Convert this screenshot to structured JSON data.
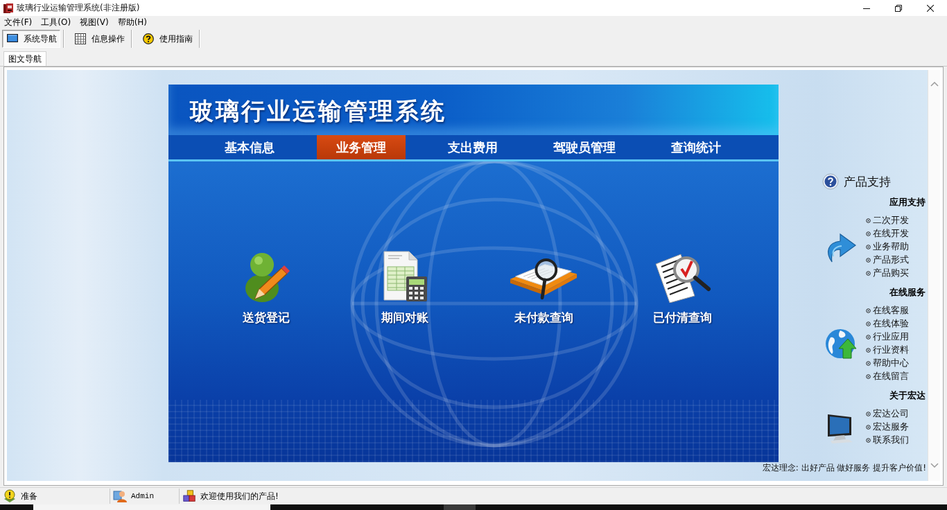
{
  "window": {
    "title": "玻璃行业运输管理系统(非注册版)"
  },
  "menu": [
    "文件(F)",
    "工具(O)",
    "视图(V)",
    "帮助(H)"
  ],
  "toolbar": [
    {
      "label": "系统导航",
      "kind": "monitor",
      "selected": true
    },
    {
      "label": "信息操作",
      "kind": "grid",
      "selected": false
    },
    {
      "label": "使用指南",
      "kind": "help",
      "selected": false
    }
  ],
  "tabs": [
    {
      "label": "图文导航",
      "selected": true
    }
  ],
  "banner": {
    "title": "玻璃行业运输管理系统",
    "nav": [
      {
        "label": "基本信息",
        "selected": false
      },
      {
        "label": "业务管理",
        "selected": true
      },
      {
        "label": "支出费用",
        "selected": false
      },
      {
        "label": "驾驶员管理",
        "selected": false
      },
      {
        "label": "查询统计",
        "selected": false
      }
    ],
    "tiles": [
      {
        "label": "送货登记",
        "kind": "person-pencil"
      },
      {
        "label": "期间对账",
        "kind": "sheet-calculator"
      },
      {
        "label": "未付款查询",
        "kind": "folder-magnifier"
      },
      {
        "label": "已付清查询",
        "kind": "checklist-magnifier"
      }
    ]
  },
  "support": {
    "title": "产品支持",
    "sections": [
      {
        "title": "应用支持",
        "kind": "arrow",
        "links": [
          "二次开发",
          "在线开发",
          "业务帮助",
          "产品形式",
          "产品购买"
        ]
      },
      {
        "title": "在线服务",
        "kind": "globe",
        "links": [
          "在线客服",
          "在线体验",
          "行业应用",
          "行业资料",
          "帮助中心",
          "在线留言"
        ]
      },
      {
        "title": "关于宏达",
        "kind": "monitor",
        "links": [
          "宏达公司",
          "宏达服务",
          "联系我们"
        ]
      }
    ],
    "slogan": "宏达理念: 出好产品 做好服务 提升客户价值!"
  },
  "status_bar": [
    {
      "text": "准备",
      "kind": "ready"
    },
    {
      "text": "Admin",
      "kind": "user"
    },
    {
      "text": "欢迎使用我们的产品!",
      "kind": "blocks"
    }
  ]
}
